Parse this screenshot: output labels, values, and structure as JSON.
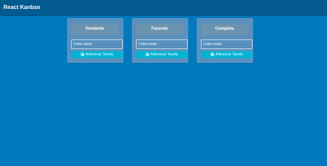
{
  "navbar": {
    "title": "React Kanban",
    "glyph": "'"
  },
  "columns": [
    {
      "title": "Pendente",
      "empty_text": "Lista vazia",
      "add_label": "Adicionar Tarefa"
    },
    {
      "title": "Fazendo",
      "empty_text": "Lista vazia",
      "add_label": "Adicionar Tarefa"
    },
    {
      "title": "Completa",
      "empty_text": "Lista vazia",
      "add_label": "Adicionar Tarefa"
    }
  ],
  "colors": {
    "background": "#0079bf",
    "navbar": "#035a8f",
    "column": "#5891bf",
    "column_header": "#6c93b0",
    "add_button": "#00b5d3"
  },
  "icons": {
    "add": "plus-circle-icon"
  }
}
